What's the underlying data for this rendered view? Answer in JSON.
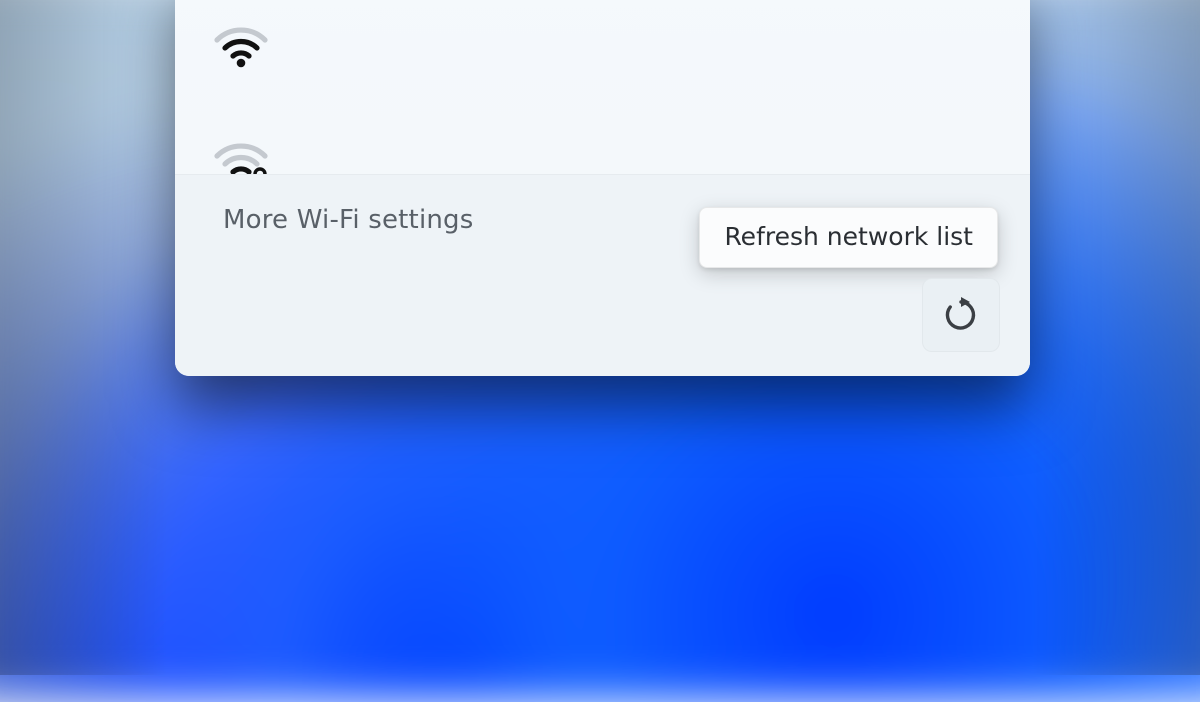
{
  "panel": {
    "networks": [
      {
        "signal_bars": 3,
        "secured": false
      },
      {
        "signal_bars": 2,
        "secured": true
      }
    ],
    "footer": {
      "more_settings_label": "More Wi-Fi settings",
      "refresh_tooltip": "Refresh network list"
    }
  }
}
